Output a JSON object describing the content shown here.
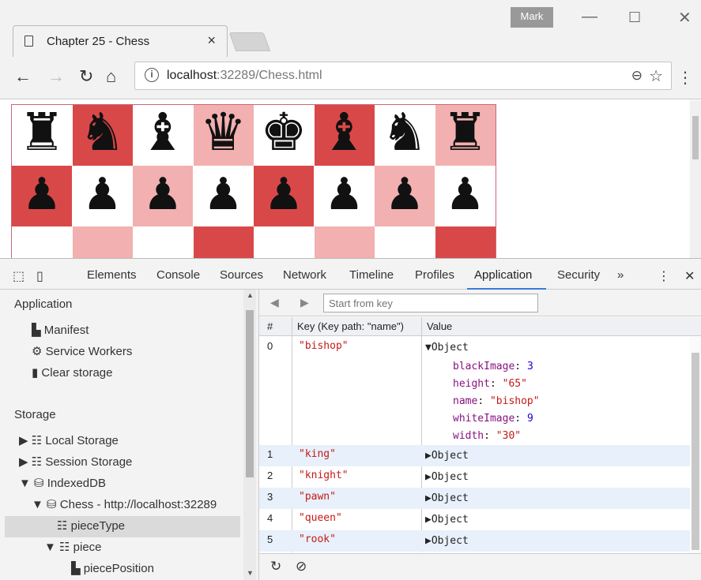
{
  "browser": {
    "profile_name": "Mark",
    "tab_title": "Chapter 25 - Chess",
    "url_host": "localhost",
    "url_rest": ":32289/Chess.html"
  },
  "board": {
    "light_color": "#ffffff",
    "dark_colors": [
      "#e06767",
      "#d94848",
      "#ea8a8a",
      "#f2b0b0"
    ],
    "back_rank": [
      "rook",
      "knight",
      "bishop",
      "queen",
      "king",
      "bishop",
      "knight",
      "rook"
    ],
    "pawn_rank": [
      "pawn",
      "pawn",
      "pawn",
      "pawn",
      "pawn",
      "pawn",
      "pawn",
      "pawn"
    ],
    "piece_color": "black"
  },
  "devtools": {
    "tabs": [
      "Elements",
      "Console",
      "Sources",
      "Network",
      "Timeline",
      "Profiles",
      "Application",
      "Security"
    ],
    "active_tab": "Application",
    "more_tabs": "»",
    "sidebar": {
      "application_header": "Application",
      "manifest": "Manifest",
      "service_workers": "Service Workers",
      "clear_storage": "Clear storage",
      "storage_header": "Storage",
      "local_storage": "Local Storage",
      "session_storage": "Session Storage",
      "indexeddb": "IndexedDB",
      "database": "Chess - http://localhost:32289",
      "store_piecetype": "pieceType",
      "store_piece": "piece",
      "index_pieceposition": "piecePosition"
    },
    "table": {
      "start_from_key_placeholder": "Start from key",
      "col_num": "#",
      "col_key": "Key (Key path: \"name\")",
      "col_value": "Value",
      "expanded_row": {
        "num": "0",
        "key": "\"bishop\"",
        "value": "▼Object",
        "properties": [
          {
            "key": "blackImage",
            "value": "3",
            "type": "num"
          },
          {
            "key": "height",
            "value": "\"65\"",
            "type": "str"
          },
          {
            "key": "name",
            "value": "\"bishop\"",
            "type": "str"
          },
          {
            "key": "whiteImage",
            "value": "9",
            "type": "num"
          },
          {
            "key": "width",
            "value": "\"30\"",
            "type": "str"
          }
        ]
      },
      "rows": [
        {
          "num": "1",
          "key": "\"king\"",
          "value": "▶Object"
        },
        {
          "num": "2",
          "key": "\"knight\"",
          "value": "▶Object"
        },
        {
          "num": "3",
          "key": "\"pawn\"",
          "value": "▶Object"
        },
        {
          "num": "4",
          "key": "\"queen\"",
          "value": "▶Object"
        },
        {
          "num": "5",
          "key": "\"rook\"",
          "value": "▶Object"
        }
      ]
    }
  }
}
